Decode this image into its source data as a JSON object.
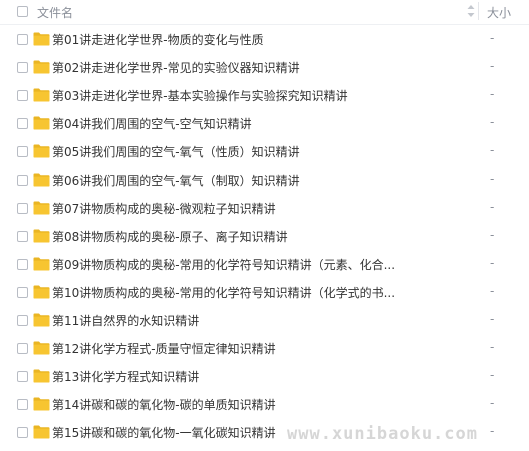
{
  "header": {
    "name_label": "文件名",
    "size_label": "大小"
  },
  "colors": {
    "folder": "#f7c531",
    "folder_tab": "#eab523",
    "text": "#333333",
    "muted": "#8a8f99"
  },
  "files": [
    {
      "name": "第01讲走进化学世界-物质的变化与性质",
      "size": "-"
    },
    {
      "name": "第02讲走进化学世界-常见的实验仪器知识精讲",
      "size": "-"
    },
    {
      "name": "第03讲走进化学世界-基本实验操作与实验探究知识精讲",
      "size": "-"
    },
    {
      "name": "第04讲我们周围的空气-空气知识精讲",
      "size": "-"
    },
    {
      "name": "第05讲我们周围的空气-氧气（性质）知识精讲",
      "size": "-"
    },
    {
      "name": "第06讲我们周围的空气-氧气（制取）知识精讲",
      "size": "-"
    },
    {
      "name": "第07讲物质构成的奥秘-微观粒子知识精讲",
      "size": "-"
    },
    {
      "name": "第08讲物质构成的奥秘-原子、离子知识精讲",
      "size": "-"
    },
    {
      "name": "第09讲物质构成的奥秘-常用的化学符号知识精讲（元素、化合...",
      "size": "-"
    },
    {
      "name": "第10讲物质构成的奥秘-常用的化学符号知识精讲（化学式的书...",
      "size": "-"
    },
    {
      "name": "第11讲自然界的水知识精讲",
      "size": "-"
    },
    {
      "name": "第12讲化学方程式-质量守恒定律知识精讲",
      "size": "-"
    },
    {
      "name": "第13讲化学方程式知识精讲",
      "size": "-"
    },
    {
      "name": "第14讲碳和碳的氧化物-碳的单质知识精讲",
      "size": "-"
    },
    {
      "name": "第15讲碳和碳的氧化物-一氧化碳知识精讲",
      "size": "-"
    }
  ],
  "watermark": "www.xunibaoku.com"
}
